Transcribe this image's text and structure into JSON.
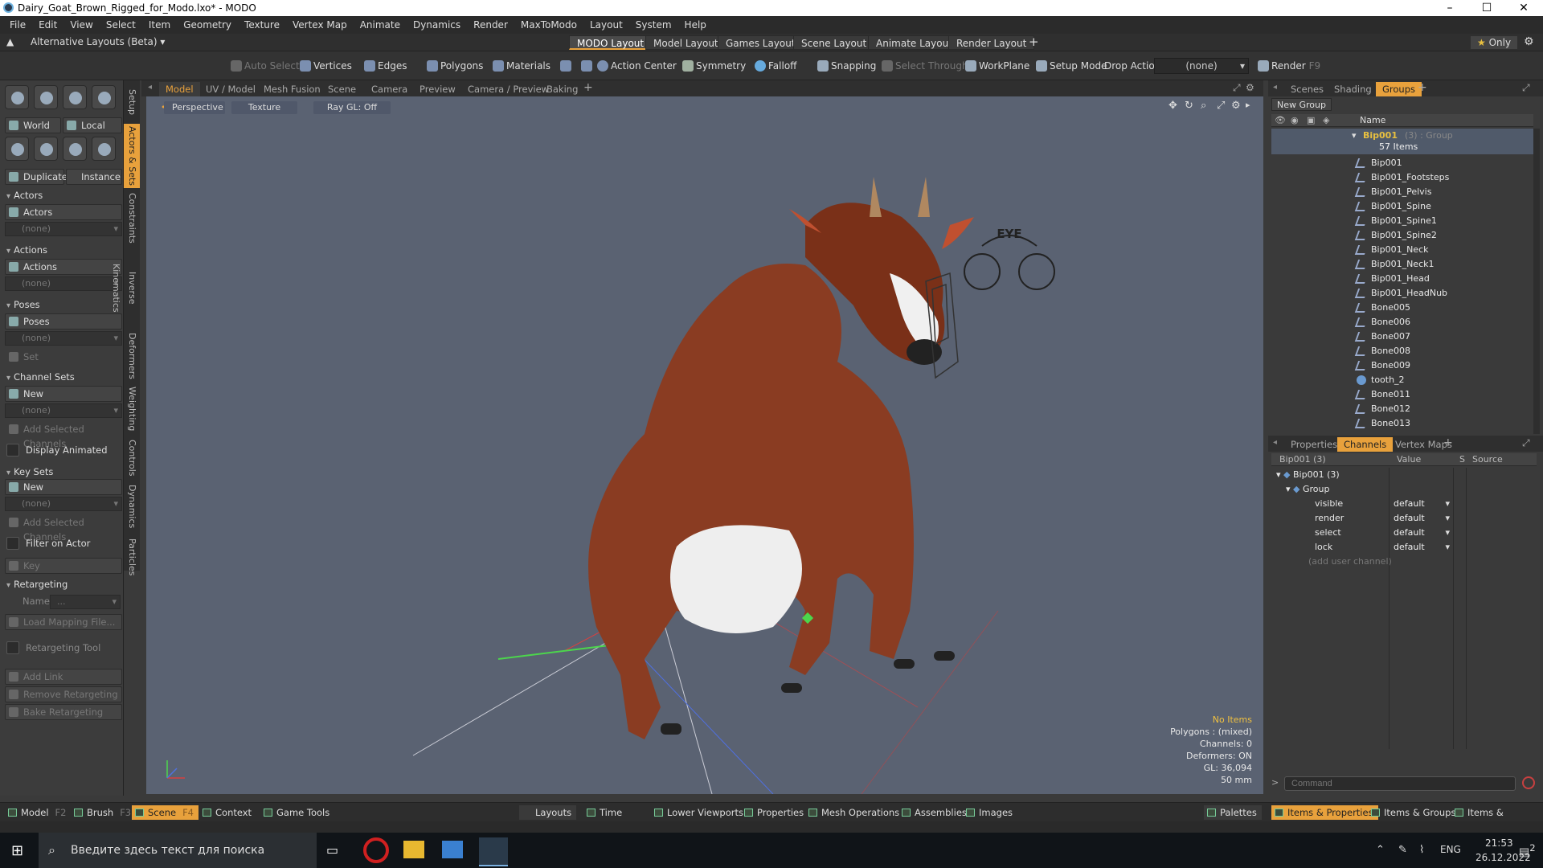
{
  "window": {
    "title": "Dairy_Goat_Brown_Rigged_for_Modo.lxo* - MODO",
    "minimize": "–",
    "maximize": "☐",
    "close": "✕"
  },
  "menu": [
    "File",
    "Edit",
    "View",
    "Select",
    "Item",
    "Geometry",
    "Texture",
    "Vertex Map",
    "Animate",
    "Dynamics",
    "Render",
    "MaxToModo",
    "Layout",
    "System",
    "Help"
  ],
  "layoutbar": {
    "layouts_label": "Alternative Layouts (Beta)",
    "tabs": [
      "MODO Layout",
      "Model Layout",
      "Games Layout",
      "Scene Layout",
      "Animate Layout",
      "Render Layout"
    ],
    "plus": "+",
    "only": "Only",
    "star": "★"
  },
  "toolbar": {
    "auto_select": "Auto Select",
    "vertices": "Vertices",
    "edges": "Edges",
    "polygons": "Polygons",
    "materials": "Materials",
    "action_center": "Action Center",
    "symmetry": "Symmetry",
    "falloff": "Falloff",
    "snapping": "Snapping",
    "select_through": "Select Through",
    "workplane": "WorkPlane",
    "setup_mode": "Setup Mode",
    "drop_action": "Drop Action",
    "drop_value": "(none)",
    "render": "Render",
    "render_key": "F9"
  },
  "left": {
    "world": "World",
    "local": "Local",
    "duplicate": "Duplicate",
    "instance": "Instance",
    "actors_head": "Actors",
    "actors": "Actors",
    "none": "(none)",
    "actions_head": "Actions",
    "actions": "Actions",
    "poses_head": "Poses",
    "poses": "Poses",
    "set": "Set",
    "channel_sets_head": "Channel Sets",
    "new": "New",
    "add_selected_channels": "Add Selected Channels",
    "display_animated": "Display Animated",
    "key_sets_head": "Key Sets",
    "filter_on_actor": "Filter on Actor",
    "key": "Key",
    "retargeting_head": "Retargeting",
    "name": "Name",
    "name_value": "...",
    "load_mapping": "Load Mapping File...",
    "retargeting_tool": "Retargeting Tool",
    "add_link": "Add Link",
    "remove_retargeting": "Remove Retargeting",
    "bake_retargeting": "Bake Retargeting"
  },
  "vtabs": [
    "Setup",
    "Actors & Sets",
    "Constraints",
    "Inverse Kinematics",
    "Deformers",
    "Weighting",
    "Controls",
    "Dynamics",
    "Particles"
  ],
  "viewport": {
    "tabs": [
      "Model",
      "UV / Model",
      "Mesh Fusion",
      "Scene",
      "Camera",
      "Preview",
      "Camera / Preview",
      "Baking"
    ],
    "plus": "+",
    "perspective": "Perspective",
    "texture": "Texture",
    "raygl": "Ray GL: Off",
    "eye_label": "EYE",
    "info": {
      "no_items": "No Items",
      "polygons": "Polygons : (mixed)",
      "channels": "Channels: 0",
      "deformers": "Deformers: ON",
      "gl": "GL: 36,094",
      "lens": "50 mm"
    }
  },
  "groups_panel": {
    "tabs": [
      "Scenes",
      "Shading",
      "Groups"
    ],
    "plus": "+",
    "new_group": "New Group",
    "name_col": "Name",
    "group_name": "Bip001",
    "group_suffix": "(3) : Group",
    "item_count": "57 Items",
    "items": [
      "Bip001",
      "Bip001_Footsteps",
      "Bip001_Pelvis",
      "Bip001_Spine",
      "Bip001_Spine1",
      "Bip001_Spine2",
      "Bip001_Neck",
      "Bip001_Neck1",
      "Bip001_Head",
      "Bip001_HeadNub",
      "Bone005",
      "Bone006",
      "Bone007",
      "Bone008",
      "Bone009",
      "tooth_2",
      "Bone011",
      "Bone012",
      "Bone013"
    ]
  },
  "channels_panel": {
    "tabs": [
      "Properties",
      "Channels",
      "Vertex Maps"
    ],
    "plus": "+",
    "cols": {
      "name": "Bip001 (3)",
      "value": "Value",
      "s": "S",
      "source": "Source"
    },
    "root": "Bip001 (3)",
    "group": "Group",
    "rows": [
      {
        "name": "visible",
        "value": "default"
      },
      {
        "name": "render",
        "value": "default"
      },
      {
        "name": "select",
        "value": "default"
      },
      {
        "name": "lock",
        "value": "default"
      }
    ],
    "add_user_channel": "(add user channel)",
    "command_placeholder": "Command"
  },
  "bottombar": {
    "model": "Model",
    "model_key": "F2",
    "brush": "Brush",
    "brush_key": "F3",
    "scene": "Scene",
    "scene_key": "F4",
    "context": "Context",
    "game_tools": "Game Tools",
    "layouts": "Layouts",
    "time": "Time",
    "lower_viewports": "Lower Viewports",
    "properties": "Properties",
    "mesh_operations": "Mesh Operations",
    "assemblies": "Assemblies",
    "images": "Images",
    "palettes": "Palettes",
    "items_properties": "Items & Properties",
    "items_groups": "Items & Groups",
    "items_shading": "Items & Shading"
  },
  "taskbar": {
    "search_placeholder": "Введите здесь текст для поиска",
    "lang": "ENG",
    "time": "21:53",
    "date": "26.12.2022",
    "notif": "2"
  },
  "colors": {
    "accent": "#e8a13c",
    "viewport_bg": "#5a6272",
    "panel_bg": "#3a3a3a"
  }
}
